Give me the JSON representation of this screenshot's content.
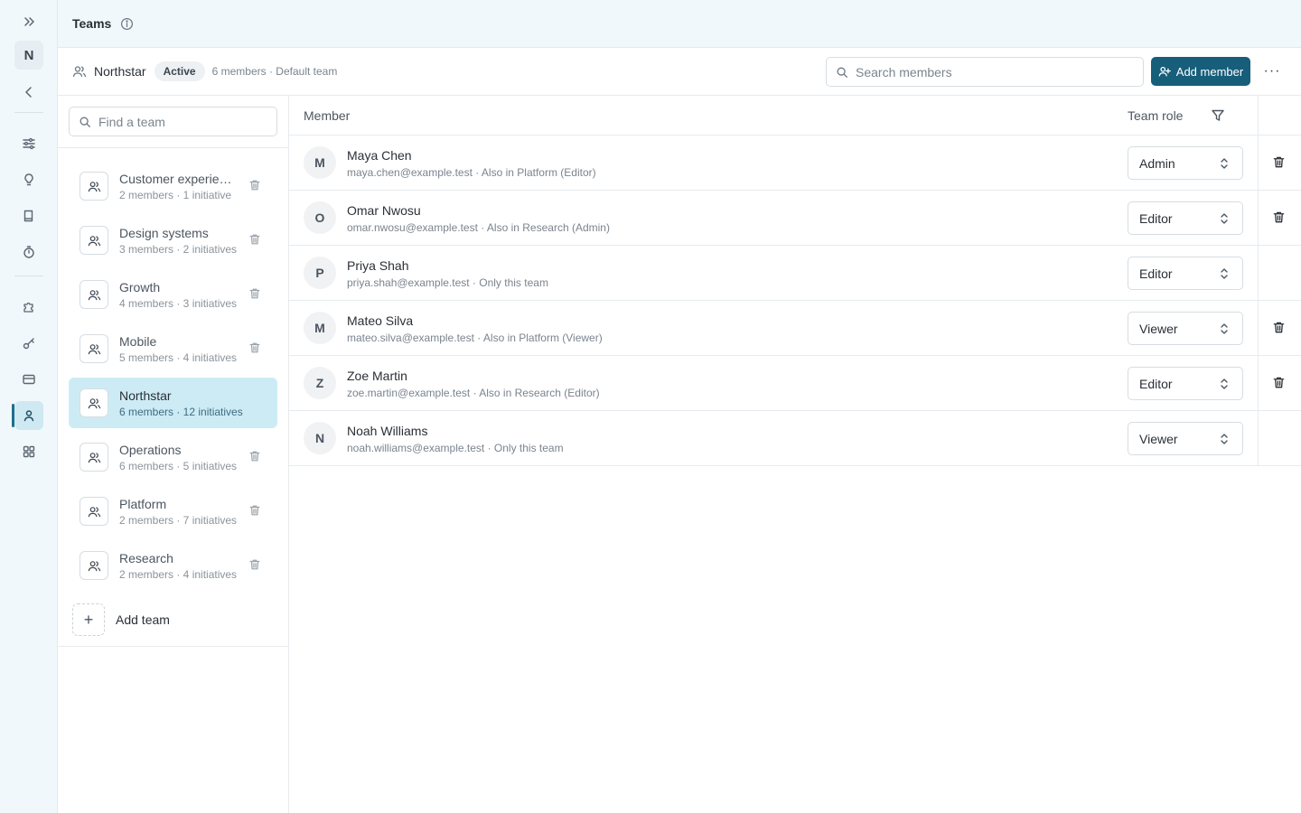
{
  "rail": {
    "workspace_initial": "N",
    "icons": [
      "expand-icon",
      "back-icon",
      "sliders-icon",
      "lightbulb-icon",
      "book-icon",
      "timer-icon",
      "puzzle-icon",
      "key-icon",
      "card-icon",
      "person-icon",
      "grid-icon"
    ]
  },
  "header": {
    "title": "Teams"
  },
  "team_header": {
    "name": "Northstar",
    "status": "Active",
    "meta": "6 members · Default team",
    "search_placeholder": "Search members",
    "add_member_label": "Add member",
    "more_label": "···"
  },
  "teams": {
    "search_placeholder": "Find a team",
    "items": [
      {
        "name": "Customer experie…",
        "meta": "2 members · 1 initiative"
      },
      {
        "name": "Design systems",
        "meta": "3 members · 2 initiatives"
      },
      {
        "name": "Growth",
        "meta": "4 members · 3 initiatives"
      },
      {
        "name": "Mobile",
        "meta": "5 members · 4 initiatives"
      },
      {
        "name": "Northstar",
        "meta": "6 members · 12 initiatives"
      },
      {
        "name": "Operations",
        "meta": "6 members · 5 initiatives"
      },
      {
        "name": "Platform",
        "meta": "2 members · 7 initiatives"
      },
      {
        "name": "Research",
        "meta": "2 members · 4 initiatives"
      }
    ],
    "add_team_label": "Add team",
    "add_team_plus": "+"
  },
  "table": {
    "col_member": "Member",
    "col_role": "Team role",
    "rows": [
      {
        "initial": "M",
        "name": "Maya Chen",
        "meta": "maya.chen@example.test · Also in Platform (Editor)",
        "role": "Admin"
      },
      {
        "initial": "O",
        "name": "Omar Nwosu",
        "meta": "omar.nwosu@example.test · Also in Research (Admin)",
        "role": "Editor"
      },
      {
        "initial": "P",
        "name": "Priya Shah",
        "meta": "priya.shah@example.test · Only this team",
        "role": "Editor"
      },
      {
        "initial": "M",
        "name": "Mateo Silva",
        "meta": "mateo.silva@example.test · Also in Platform (Viewer)",
        "role": "Viewer"
      },
      {
        "initial": "Z",
        "name": "Zoe Martin",
        "meta": "zoe.martin@example.test · Also in Research (Editor)",
        "role": "Editor"
      },
      {
        "initial": "N",
        "name": "Noah Williams",
        "meta": "noah.williams@example.test · Only this team",
        "role": "Viewer"
      }
    ]
  },
  "colors": {
    "accent": "#175e7a",
    "selected_bg": "#cdebf5",
    "rail_bg": "#f1f8fb"
  }
}
